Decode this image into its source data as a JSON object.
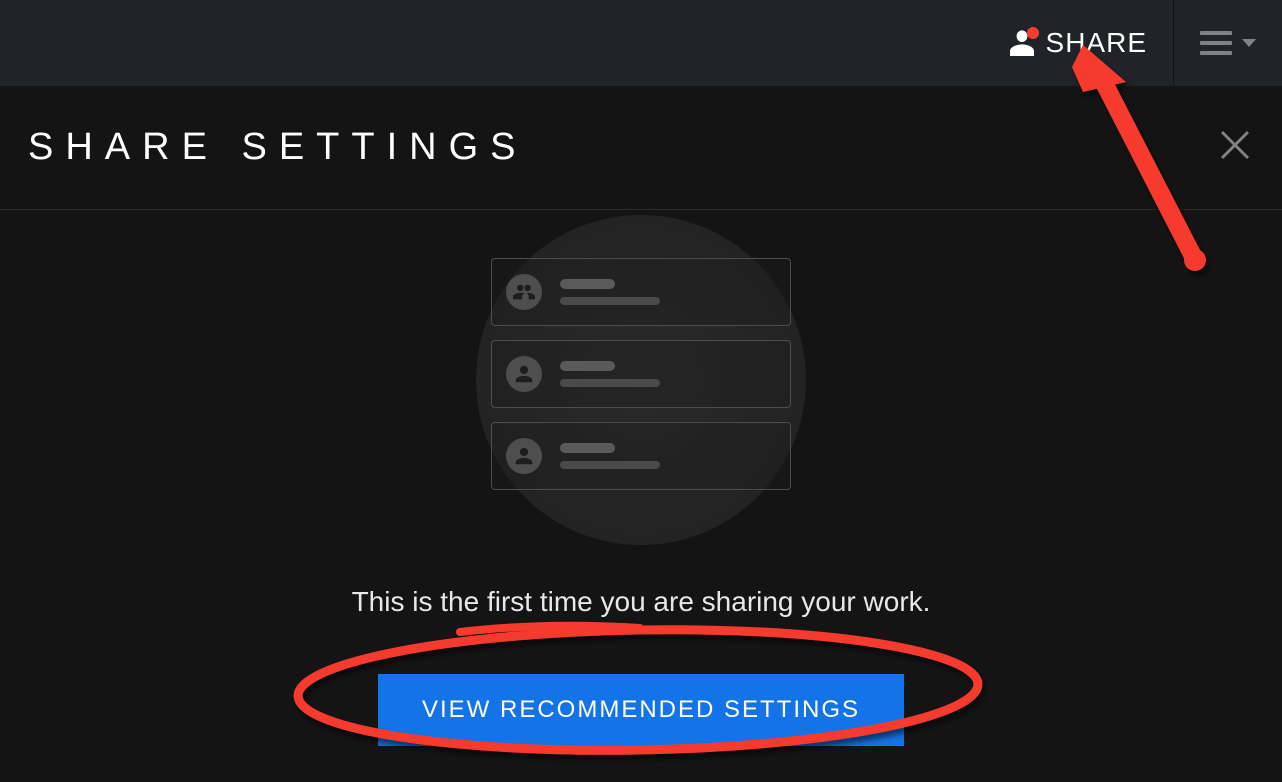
{
  "topbar": {
    "share_label": "SHARE"
  },
  "panel": {
    "title": "SHARE SETTINGS",
    "message": "This is the first time you are sharing your work.",
    "cta_label": "VIEW RECOMMENDED SETTINGS"
  }
}
